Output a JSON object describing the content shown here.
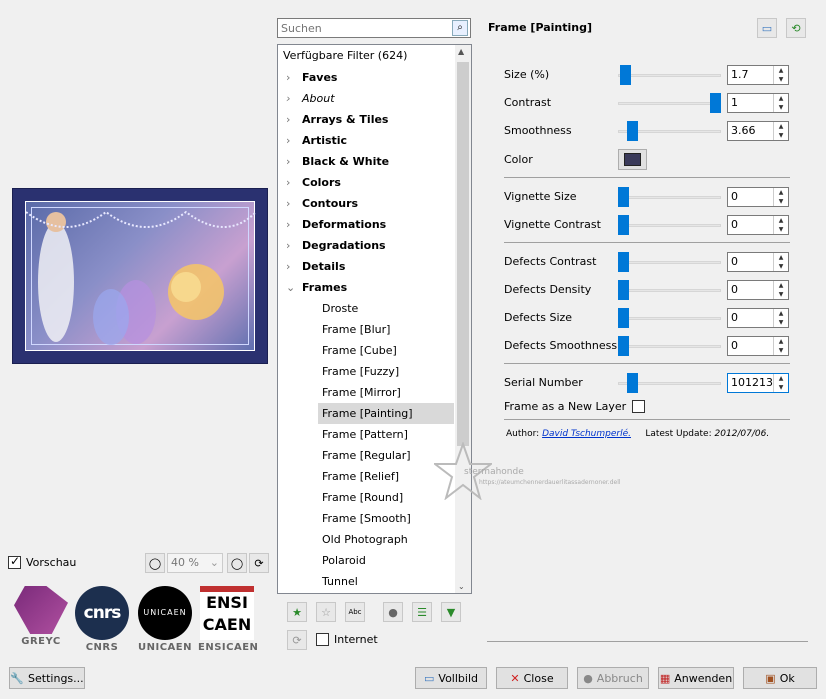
{
  "preview": {
    "label": "Vorschau",
    "zoom": "40 %"
  },
  "logos": [
    {
      "name": "GREYC"
    },
    {
      "name": "CNRS",
      "mark": "cnrs"
    },
    {
      "name": "UNICAEN",
      "mark": "UNICAEN"
    },
    {
      "name": "ENSICAEN",
      "mark_top": "ENSI",
      "mark_bottom": "CAEN"
    }
  ],
  "settings_button": "Settings...",
  "search": {
    "placeholder": "Suchen"
  },
  "filters": {
    "header": "Verfügbare Filter (624)",
    "categories": [
      "Faves",
      "About",
      "Arrays & Tiles",
      "Artistic",
      "Black & White",
      "Colors",
      "Contours",
      "Deformations",
      "Degradations",
      "Details",
      "Frames"
    ],
    "frames_children": [
      "Droste",
      "Frame [Blur]",
      "Frame [Cube]",
      "Frame [Fuzzy]",
      "Frame [Mirror]",
      "Frame [Painting]",
      "Frame [Pattern]",
      "Frame [Regular]",
      "Frame [Relief]",
      "Frame [Round]",
      "Frame [Smooth]",
      "Old Photograph",
      "Polaroid",
      "Tunnel"
    ],
    "selected": "Frame [Painting]"
  },
  "internet_label": "Internet",
  "panel": {
    "title": "Frame [Painting]",
    "params": [
      {
        "label": "Size (%)",
        "value": "1.7",
        "pos": 0.02
      },
      {
        "label": "Contrast",
        "value": "1",
        "pos": 1.0
      },
      {
        "label": "Smoothness",
        "value": "3.66",
        "pos": 0.1
      },
      {
        "label": "Vignette Size",
        "value": "0",
        "pos": 0.0
      },
      {
        "label": "Vignette Contrast",
        "value": "0",
        "pos": 0.0
      },
      {
        "label": "Defects Contrast",
        "value": "0",
        "pos": 0.0
      },
      {
        "label": "Defects Density",
        "value": "0",
        "pos": 0.0
      },
      {
        "label": "Defects Size",
        "value": "0",
        "pos": 0.0
      },
      {
        "label": "Defects Smoothness",
        "value": "0",
        "pos": 0.0
      },
      {
        "label": "Serial Number",
        "value": "101213",
        "pos": 0.1
      }
    ],
    "color_label": "Color",
    "color_value": "#3a3a5a",
    "new_layer_label": "Frame as a New Layer",
    "author_prefix": "Author:",
    "author_name": "David Tschumperlé.",
    "update_label": "Latest Update:",
    "update_date": "2012/07/06."
  },
  "watermark": {
    "line1": "stermahonde",
    "line2": "https://ateumchennerdauerlitassadernoner.dell"
  },
  "buttons": {
    "fullscreen": "Vollbild",
    "close": "Close",
    "cancel": "Abbruch",
    "apply": "Anwenden",
    "ok": "Ok"
  }
}
